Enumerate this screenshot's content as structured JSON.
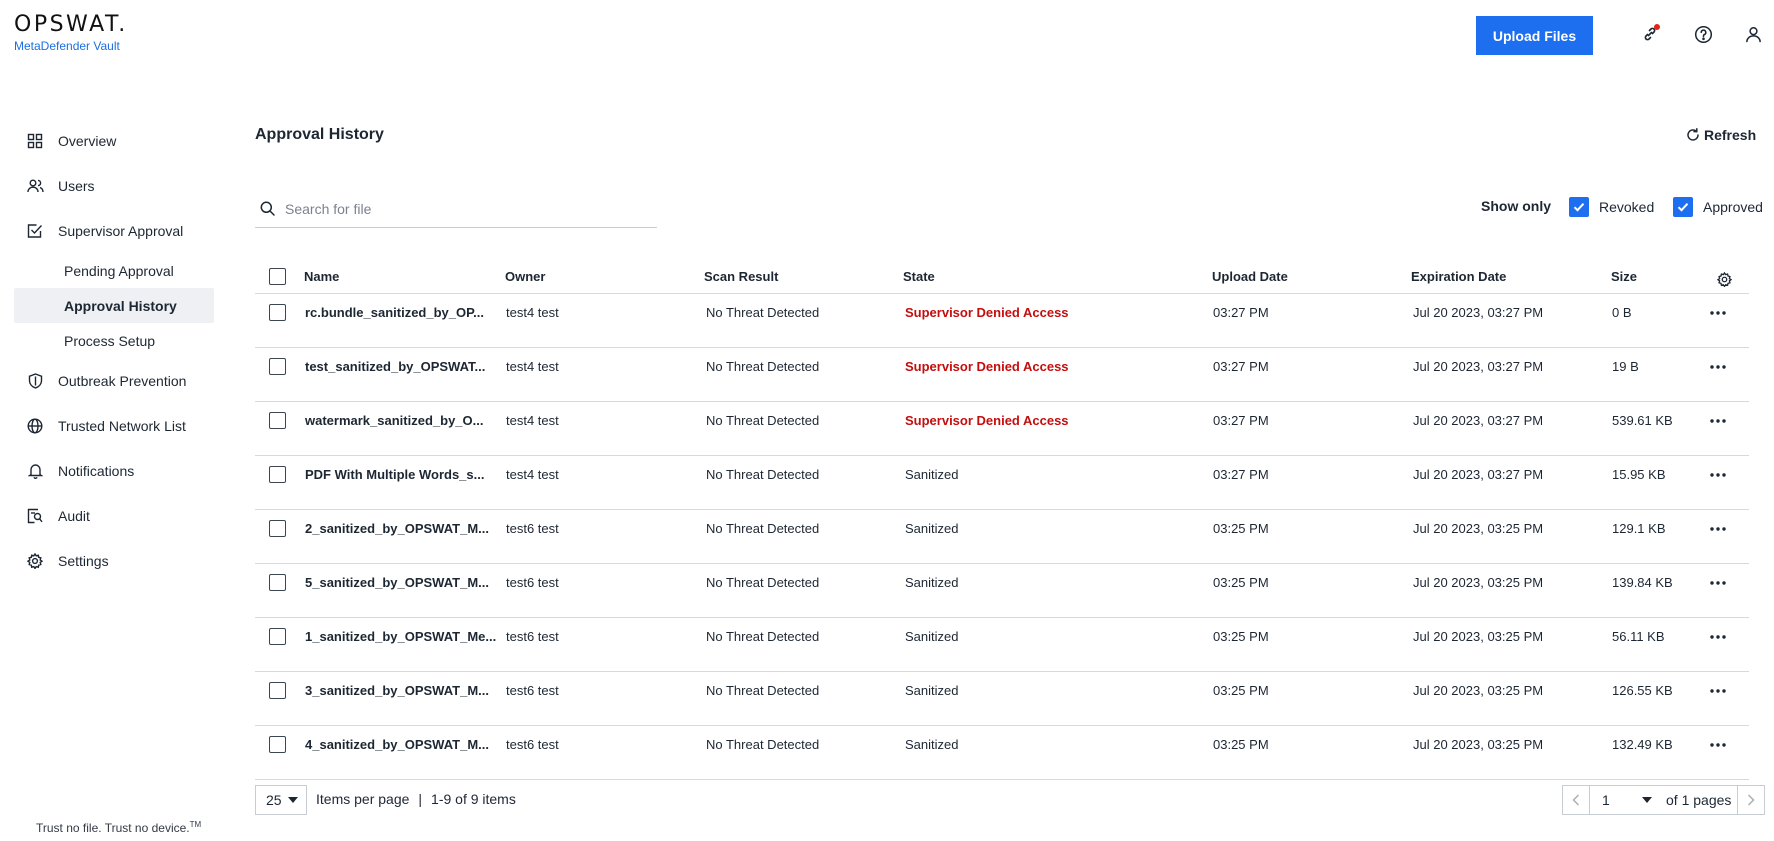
{
  "header": {
    "logo_text": "OPSWAT.",
    "product_name": "MetaDefender Vault",
    "upload_button": "Upload Files"
  },
  "sidebar": {
    "items": [
      {
        "label": "Overview",
        "icon": "grid-icon"
      },
      {
        "label": "Users",
        "icon": "users-icon"
      },
      {
        "label": "Supervisor Approval",
        "icon": "checkbox-icon"
      }
    ],
    "sub_items": [
      {
        "label": "Pending Approval",
        "active": false
      },
      {
        "label": "Approval History",
        "active": true
      },
      {
        "label": "Process Setup",
        "active": false
      }
    ],
    "items_after": [
      {
        "label": "Outbreak Prevention",
        "icon": "shield-icon"
      },
      {
        "label": "Trusted Network List",
        "icon": "globe-icon"
      },
      {
        "label": "Notifications",
        "icon": "bell-icon"
      },
      {
        "label": "Audit",
        "icon": "audit-icon"
      },
      {
        "label": "Settings",
        "icon": "gear-icon"
      }
    ],
    "footer_tagline": "Trust no file. Trust no device.",
    "footer_tm": "TM"
  },
  "main": {
    "title": "Approval History",
    "refresh_label": "Refresh",
    "search_placeholder": "Search for file",
    "show_only_label": "Show only",
    "filters": [
      {
        "label": "Revoked",
        "checked": true
      },
      {
        "label": "Approved",
        "checked": true
      }
    ],
    "columns": [
      "Name",
      "Owner",
      "Scan Result",
      "State",
      "Upload Date",
      "Expiration Date",
      "Size"
    ],
    "rows": [
      {
        "name": "rc.bundle_sanitized_by_OP...",
        "owner": "test4 test",
        "scan": "No Threat Detected",
        "state": "Supervisor Denied Access",
        "denied": true,
        "upload": "03:27 PM",
        "expiration": "Jul 20 2023, 03:27 PM",
        "size": "0 B"
      },
      {
        "name": "test_sanitized_by_OPSWAT...",
        "owner": "test4 test",
        "scan": "No Threat Detected",
        "state": "Supervisor Denied Access",
        "denied": true,
        "upload": "03:27 PM",
        "expiration": "Jul 20 2023, 03:27 PM",
        "size": "19 B"
      },
      {
        "name": "watermark_sanitized_by_O...",
        "owner": "test4 test",
        "scan": "No Threat Detected",
        "state": "Supervisor Denied Access",
        "denied": true,
        "upload": "03:27 PM",
        "expiration": "Jul 20 2023, 03:27 PM",
        "size": "539.61 KB"
      },
      {
        "name": "PDF With Multiple Words_s...",
        "owner": "test4 test",
        "scan": "No Threat Detected",
        "state": "Sanitized",
        "denied": false,
        "upload": "03:27 PM",
        "expiration": "Jul 20 2023, 03:27 PM",
        "size": "15.95 KB"
      },
      {
        "name": "2_sanitized_by_OPSWAT_M...",
        "owner": "test6 test",
        "scan": "No Threat Detected",
        "state": "Sanitized",
        "denied": false,
        "upload": "03:25 PM",
        "expiration": "Jul 20 2023, 03:25 PM",
        "size": "129.1 KB"
      },
      {
        "name": "5_sanitized_by_OPSWAT_M...",
        "owner": "test6 test",
        "scan": "No Threat Detected",
        "state": "Sanitized",
        "denied": false,
        "upload": "03:25 PM",
        "expiration": "Jul 20 2023, 03:25 PM",
        "size": "139.84 KB"
      },
      {
        "name": "1_sanitized_by_OPSWAT_Me...",
        "owner": "test6 test",
        "scan": "No Threat Detected",
        "state": "Sanitized",
        "denied": false,
        "upload": "03:25 PM",
        "expiration": "Jul 20 2023, 03:25 PM",
        "size": "56.11 KB"
      },
      {
        "name": "3_sanitized_by_OPSWAT_M...",
        "owner": "test6 test",
        "scan": "No Threat Detected",
        "state": "Sanitized",
        "denied": false,
        "upload": "03:25 PM",
        "expiration": "Jul 20 2023, 03:25 PM",
        "size": "126.55 KB"
      },
      {
        "name": "4_sanitized_by_OPSWAT_M...",
        "owner": "test6 test",
        "scan": "No Threat Detected",
        "state": "Sanitized",
        "denied": false,
        "upload": "03:25 PM",
        "expiration": "Jul 20 2023, 03:25 PM",
        "size": "132.49 KB"
      }
    ]
  },
  "pagination": {
    "per_page": "25",
    "per_page_label": "Items per page",
    "separator": "|",
    "items_range": "1-9 of 9 items",
    "current_page": "1",
    "of_pages": "of 1 pages"
  },
  "colors": {
    "accent": "#1d6ff0",
    "denied": "#c40e0e",
    "notification_dot": "#e0241a",
    "active_nav_bg": "#eef0f4"
  }
}
